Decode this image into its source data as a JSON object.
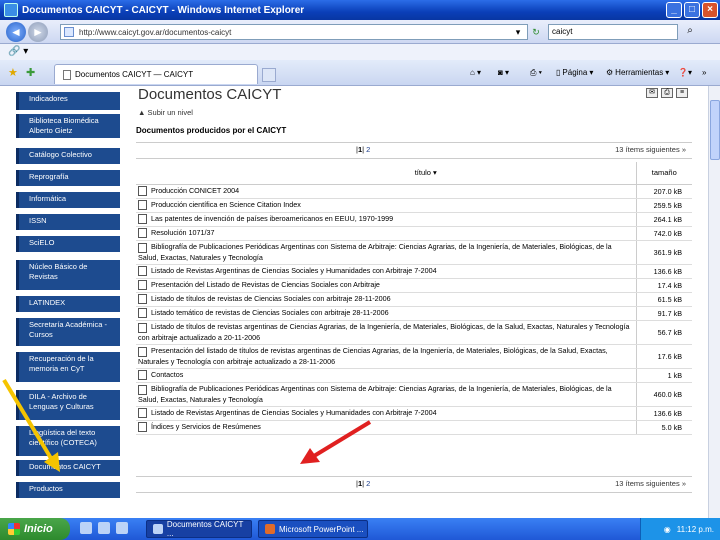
{
  "window": {
    "title": "Documentos CAICYT - CAICYT - Windows Internet Explorer"
  },
  "address_bar": {
    "url": "http://www.caicyt.gov.ar/documentos-caicyt",
    "search_value": "caicyt"
  },
  "tab": {
    "label": "Documentos CAICYT — CAICYT"
  },
  "commands": {
    "page": "Página",
    "tools": "Herramientas"
  },
  "sidebar": {
    "items": [
      {
        "label": "Indicadores"
      },
      {
        "label": "Biblioteca Biomédica Alberto Gietz"
      },
      {
        "label": "Catálogo Colectivo"
      },
      {
        "label": "Reprografía"
      },
      {
        "label": "Informática"
      },
      {
        "label": "ISSN"
      },
      {
        "label": "SciELO"
      },
      {
        "label": "Núcleo Básico de Revistas"
      },
      {
        "label": "LATINDEX"
      },
      {
        "label": "Secretaría Académica - Cursos"
      },
      {
        "label": "Recuperación de la memoria en CyT"
      },
      {
        "label": "DILA - Archivo de Lenguas y Culturas"
      },
      {
        "label": "Lingüística del texto científico (COTECA)"
      },
      {
        "label": "Documentos CAICYT"
      },
      {
        "label": "Productos"
      }
    ]
  },
  "main": {
    "title": "Documentos CAICYT",
    "up_link": "Subir un nivel",
    "subtitle": "Documentos producidos por el CAICYT",
    "pager": {
      "current": "1",
      "other": "2",
      "next": "13 ítems siguientes"
    },
    "columns": {
      "title": "título",
      "size": "tamaño"
    },
    "rows": [
      {
        "title": "Producción CONICET 2004",
        "size": "207.0 kB"
      },
      {
        "title": "Producción científica en Science Citation Index",
        "size": "259.5 kB"
      },
      {
        "title": "Las patentes de invención de países iberoamericanos en EEUU, 1970-1999",
        "size": "264.1 kB"
      },
      {
        "title": "Resolución 1071/37",
        "size": "742.0 kB"
      },
      {
        "title": "Bibliografía de Publicaciones Periódicas Argentinas con Sistema de Arbitraje: Ciencias Agrarias, de la Ingeniería, de Materiales, Biológicas, de la Salud, Exactas, Naturales y Tecnología",
        "size": "361.9 kB"
      },
      {
        "title": "Listado de Revistas Argentinas de Ciencias Sociales y Humanidades con Arbitraje 7-2004",
        "size": "136.6 kB"
      },
      {
        "title": "Presentación del Listado de Revistas de Ciencias Sociales con Arbitraje",
        "size": "17.4 kB"
      },
      {
        "title": "Listado de títulos de revistas de Ciencias Sociales con arbitraje 28-11-2006",
        "size": "61.5 kB"
      },
      {
        "title": "Listado temático de revistas de Ciencias Sociales con arbitraje 28-11-2006",
        "size": "91.7 kB"
      },
      {
        "title": "Listado de títulos de revistas argentinas de Ciencias Agrarias, de la Ingeniería, de Materiales, Biológicas, de la Salud, Exactas, Naturales y Tecnología con arbitraje actualizado a 20-11-2006",
        "size": "56.7 kB"
      },
      {
        "title": "Presentación del listado de títulos de revistas argentinas de Ciencias Agrarias, de la Ingeniería, de Materiales, Biológicas, de la Salud, Exactas, Naturales y Tecnología con arbitraje actualizado a 28-11-2006",
        "size": "17.6 kB"
      },
      {
        "title": "Contactos",
        "size": "1 kB"
      },
      {
        "title": "Bibliografía de Publicaciones Periódicas Argentinas con Sistema de Arbitraje: Ciencias Agrarias, de la Ingeniería, de Materiales, Biológicas, de la Salud, Exactas, Naturales y Tecnología",
        "size": "460.0 kB"
      },
      {
        "title": "Listado de Revistas Argentinas de Ciencias Sociales y Humanidades con Arbitraje 7-2004",
        "size": "136.6 kB"
      },
      {
        "title": "Índices y Servicios de Resúmenes",
        "size": "5.0 kB"
      }
    ]
  },
  "taskbar": {
    "start_label": "Inicio",
    "tasks": [
      {
        "label": "Documentos CAICYT ..."
      },
      {
        "label": "Microsoft PowerPoint ..."
      }
    ],
    "clock": "11:12 p.m."
  },
  "colors": {
    "sidebar_bg": "#1d4b8f",
    "arrow_yellow": "#f5c400",
    "arrow_red": "#e02020"
  }
}
